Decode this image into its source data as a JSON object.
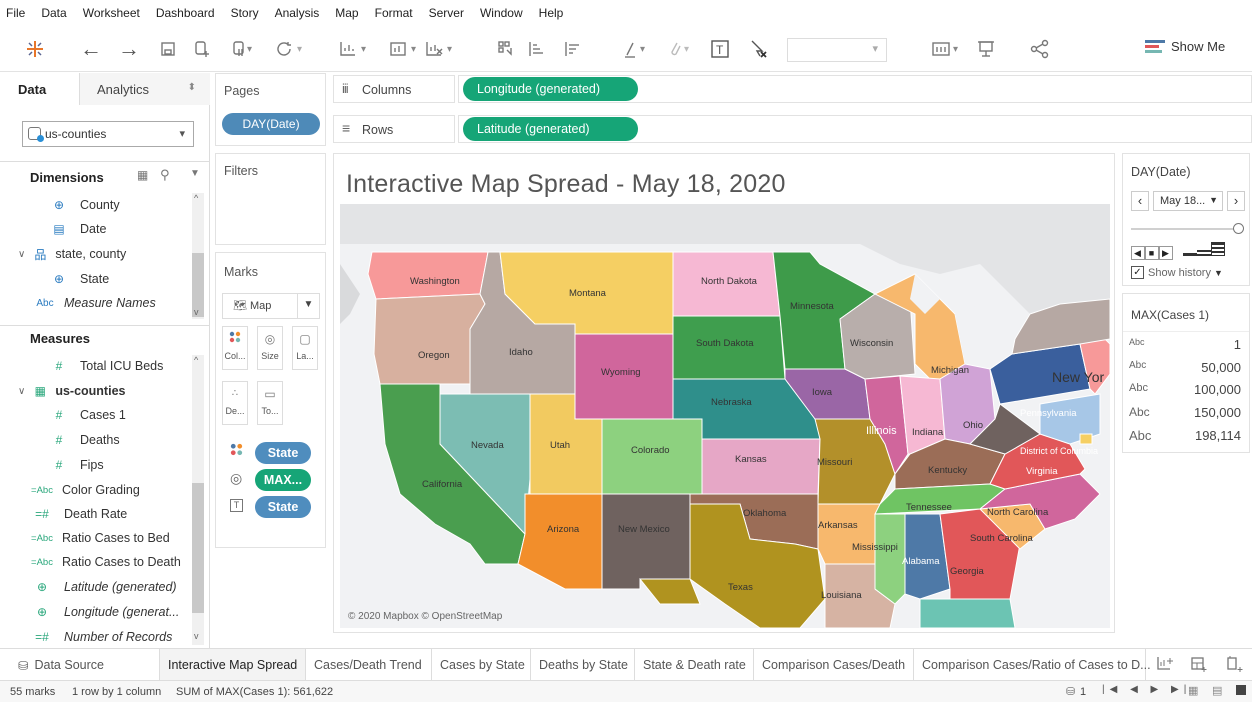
{
  "menu": [
    "File",
    "Data",
    "Worksheet",
    "Dashboard",
    "Story",
    "Analysis",
    "Map",
    "Format",
    "Server",
    "Window",
    "Help"
  ],
  "toolbar": {
    "show_me": "Show Me"
  },
  "left_pane": {
    "tab_data": "Data",
    "tab_analytics": "Analytics",
    "datasource": "us-counties",
    "dimensions_title": "Dimensions",
    "dimensions": [
      {
        "label": "County",
        "icon": "globe-icon"
      },
      {
        "label": "Date",
        "icon": "calendar-icon"
      },
      {
        "label": "state, county",
        "icon": "hierarchy-icon"
      },
      {
        "label": "State",
        "icon": "globe-icon"
      },
      {
        "label": "Measure Names",
        "icon": "abc-icon"
      }
    ],
    "measures_title": "Measures",
    "measures": [
      {
        "label": "Total ICU Beds",
        "icon": "hash-icon"
      },
      {
        "label": "us-counties",
        "icon": "table-icon"
      },
      {
        "label": "Cases 1",
        "icon": "hash-icon"
      },
      {
        "label": "Deaths",
        "icon": "hash-icon"
      },
      {
        "label": "Fips",
        "icon": "hash-icon"
      },
      {
        "label": "Color Grading",
        "icon": "calc-abc-icon"
      },
      {
        "label": "Death Rate",
        "icon": "calc-hash-icon"
      },
      {
        "label": "Ratio Cases to Bed",
        "icon": "calc-abc-icon"
      },
      {
        "label": "Ratio Cases to Death",
        "icon": "calc-abc-icon"
      },
      {
        "label": "Latitude (generated)",
        "icon": "globe-icon"
      },
      {
        "label": "Longitude (generat...",
        "icon": "globe-icon"
      },
      {
        "label": "Number of Records",
        "icon": "calc-hash-icon"
      }
    ]
  },
  "pages": {
    "title": "Pages",
    "pill": "DAY(Date)"
  },
  "filters": {
    "title": "Filters"
  },
  "marks": {
    "title": "Marks",
    "type": "Map",
    "buttons": [
      "Col...",
      "Size",
      "La...",
      "De...",
      "To..."
    ],
    "pills": [
      "State",
      "MAX...",
      "State"
    ]
  },
  "shelves": {
    "columns_label": "Columns",
    "columns_pill": "Longitude (generated)",
    "rows_label": "Rows",
    "rows_pill": "Latitude (generated)"
  },
  "view": {
    "title": "Interactive Map Spread - May 18, 2020",
    "attribution": "© 2020 Mapbox © OpenStreetMap"
  },
  "states": {
    "washington": "Washington",
    "oregon": "Oregon",
    "california": "California",
    "idaho": "Idaho",
    "nevada": "Nevada",
    "montana": "Montana",
    "wyoming": "Wyoming",
    "utah": "Utah",
    "arizona": "Arizona",
    "colorado": "Colorado",
    "new_mexico": "New Mexico",
    "north_dakota": "North Dakota",
    "south_dakota": "South Dakota",
    "nebraska": "Nebraska",
    "kansas": "Kansas",
    "oklahoma": "Oklahoma",
    "texas": "Texas",
    "minnesota": "Minnesota",
    "iowa": "Iowa",
    "missouri": "Missouri",
    "arkansas": "Arkansas",
    "louisiana": "Louisiana",
    "wisconsin": "Wisconsin",
    "illinois": "Illinois",
    "michigan": "Michigan",
    "indiana": "Indiana",
    "ohio": "Ohio",
    "kentucky": "Kentucky",
    "tennessee": "Tennessee",
    "mississippi": "Mississippi",
    "alabama": "Alabama",
    "georgia": "Georgia",
    "south_carolina": "South Carolina",
    "north_carolina": "North Carolina",
    "virginia": "Virginia",
    "pennsylvania": "Pennsylvania",
    "new_york": "New Yor",
    "dc": "District of Columbia"
  },
  "page_control": {
    "title": "DAY(Date)",
    "value": "May 18...",
    "show_history": "Show history"
  },
  "legend": {
    "title": "MAX(Cases 1)",
    "prefix": "Abc",
    "values": [
      "1",
      "50,000",
      "100,000",
      "150,000",
      "198,114"
    ]
  },
  "tabs": {
    "data_source": "Data Source",
    "sheets": [
      "Interactive Map Spread",
      "Cases/Death Trend",
      "Cases by State",
      "Deaths by State",
      "State & Death rate",
      "Comparison Cases/Death",
      "Comparison Cases/Ratio of Cases to D..."
    ]
  },
  "status": {
    "marks": "55 marks",
    "rows_cols": "1 row by 1 column",
    "sum": "SUM of MAX(Cases 1): 561,622",
    "page": "1"
  },
  "colors": {
    "pill_green": "#16a577",
    "pill_blue": "#4e8ab8"
  }
}
